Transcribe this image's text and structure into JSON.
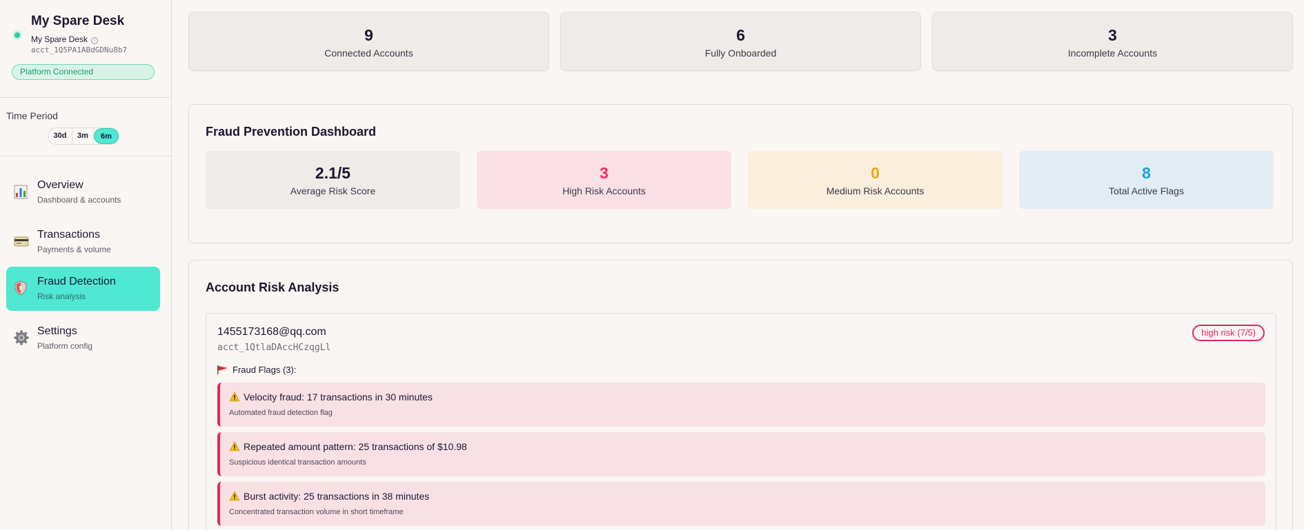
{
  "sidebar": {
    "brand": {
      "title": "My Spare Desk",
      "subtitle": "My Spare Desk",
      "account_id": "acct_1Q5PA1ABdGDNu8b7",
      "status": "Platform Connected"
    },
    "time_period": {
      "label": "Time Period",
      "options": [
        "30d",
        "3m",
        "6m"
      ],
      "selected": "6m"
    },
    "nav": [
      {
        "title": "Overview",
        "subtitle": "Dashboard & accounts",
        "icon": "bar-chart-icon",
        "active": false
      },
      {
        "title": "Transactions",
        "subtitle": "Payments & volume",
        "icon": "credit-card-icon",
        "active": false
      },
      {
        "title": "Fraud Detection",
        "subtitle": "Risk analysis",
        "icon": "shield-icon",
        "active": true
      },
      {
        "title": "Settings",
        "subtitle": "Platform config",
        "icon": "gear-icon",
        "active": false
      }
    ]
  },
  "summary": [
    {
      "value": "9",
      "label": "Connected Accounts"
    },
    {
      "value": "6",
      "label": "Fully Onboarded"
    },
    {
      "value": "3",
      "label": "Incomplete Accounts"
    }
  ],
  "fraud_dashboard": {
    "title": "Fraud Prevention Dashboard",
    "cards": [
      {
        "value": "2.1/5",
        "label": "Average Risk Score",
        "color": "#1c1730",
        "bg": "#efebe8"
      },
      {
        "value": "3",
        "label": "High Risk Accounts",
        "color": "#e8325e",
        "bg": "#fae0e5"
      },
      {
        "value": "0",
        "label": "Medium Risk Accounts",
        "color": "#e9a70f",
        "bg": "#f9efdc"
      },
      {
        "value": "8",
        "label": "Total Active Flags",
        "color": "#16a3d8",
        "bg": "#e1edf3"
      }
    ]
  },
  "risk_analysis": {
    "title": "Account Risk Analysis",
    "account": {
      "email": "1455173168@qq.com",
      "id": "acct_1QtlaDAccHCzqgLl",
      "risk_badge": "high risk (7/5)",
      "flags_header": "Fraud Flags (3):",
      "flags": [
        {
          "title": "Velocity fraud: 17 transactions in 30 minutes",
          "description": "Automated fraud detection flag"
        },
        {
          "title": "Repeated amount pattern: 25 transactions of $10.98",
          "description": "Suspicious identical transaction amounts"
        },
        {
          "title": "Burst activity: 25 transactions in 38 minutes",
          "description": "Concentrated transaction volume in short timeframe"
        }
      ]
    }
  },
  "colors": {
    "accent": "#4fe8d3",
    "danger": "#e0285a",
    "success": "#34c99a"
  }
}
